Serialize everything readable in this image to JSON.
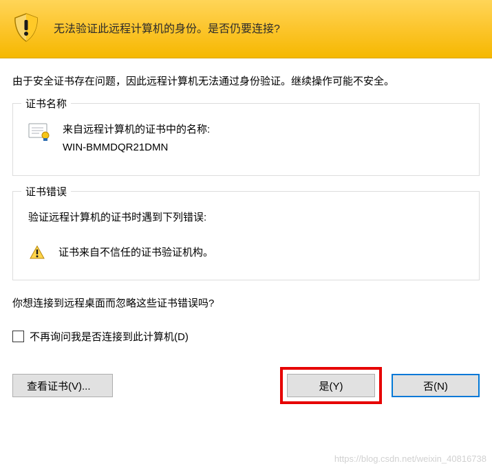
{
  "header": {
    "title": "无法验证此远程计算机的身份。是否仍要连接?"
  },
  "warning_text": "由于安全证书存在问题，因此远程计算机无法通过身份验证。继续操作可能不安全。",
  "cert_name": {
    "legend": "证书名称",
    "label": "来自远程计算机的证书中的名称:",
    "value": "WIN-BMMDQR21DMN"
  },
  "cert_errors": {
    "legend": "证书错误",
    "intro": "验证远程计算机的证书时遇到下列错误:",
    "items": [
      "证书来自不信任的证书验证机构。"
    ]
  },
  "question": "你想连接到远程桌面而忽略这些证书错误吗?",
  "checkbox": {
    "label": "不再询问我是否连接到此计算机(D)"
  },
  "buttons": {
    "view_cert": "查看证书(V)...",
    "yes": "是(Y)",
    "no": "否(N)"
  },
  "watermark": "https://blog.csdn.net/weixin_40816738"
}
